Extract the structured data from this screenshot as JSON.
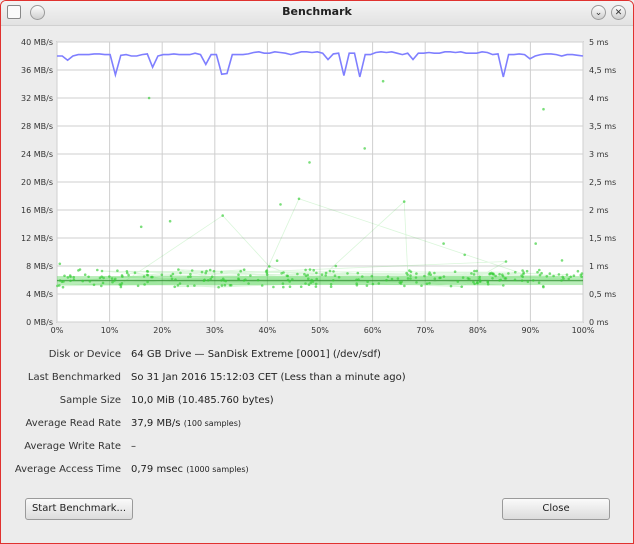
{
  "window": {
    "title": "Benchmark"
  },
  "chart_data": {
    "type": "line",
    "y_left": {
      "label": "",
      "unit": "MB/s",
      "min": 0,
      "max": 40,
      "ticks": [
        "0 MB/s",
        "4 MB/s",
        "8 MB/s",
        "12 MB/s",
        "16 MB/s",
        "20 MB/s",
        "24 MB/s",
        "28 MB/s",
        "32 MB/s",
        "36 MB/s",
        "40 MB/s"
      ]
    },
    "y_right": {
      "label": "",
      "unit": "ms",
      "min": 0,
      "max": 5,
      "ticks": [
        "0 ms",
        "0,5 ms",
        "1 ms",
        "1,5 ms",
        "2 ms",
        "2,5 ms",
        "3 ms",
        "3,5 ms",
        "4 ms",
        "4,5 ms",
        "5 ms"
      ]
    },
    "x_ticks": [
      "0%",
      "10%",
      "20%",
      "30%",
      "40%",
      "50%",
      "60%",
      "70%",
      "80%",
      "90%",
      "100%"
    ],
    "grid": true,
    "read_rate_series": {
      "color": "#7f7fff",
      "x": [
        0,
        1,
        2,
        3,
        4,
        5,
        6,
        7,
        8,
        9,
        10,
        11,
        12,
        13,
        14,
        15,
        16,
        17,
        18,
        19,
        20,
        21,
        22,
        23,
        24,
        25,
        26,
        27,
        28,
        29,
        30,
        31,
        32,
        33,
        34,
        35,
        36,
        37,
        38,
        39,
        40,
        41,
        42,
        43,
        44,
        45,
        46,
        47,
        48,
        49,
        50,
        51,
        52,
        53,
        54,
        55,
        56,
        57,
        58,
        59,
        60,
        61,
        62,
        63,
        64,
        65,
        66,
        67,
        68,
        69,
        70,
        71,
        72,
        73,
        74,
        75,
        76,
        77,
        78,
        79,
        80,
        81,
        82,
        83,
        84,
        85,
        86,
        87,
        88,
        89,
        90,
        91,
        92,
        93,
        94,
        95,
        96,
        97,
        98,
        99
      ],
      "y": [
        38.0,
        38.0,
        37.4,
        38.0,
        38.2,
        38.2,
        38.2,
        38.3,
        38.3,
        38.2,
        38.2,
        35.3,
        38.1,
        38.2,
        38.0,
        38.0,
        38.2,
        38.3,
        36.4,
        38.0,
        38.2,
        38.2,
        38.3,
        38.2,
        38.2,
        38.2,
        38.4,
        38.2,
        36.8,
        38.2,
        38.2,
        35.4,
        35.5,
        38.2,
        38.2,
        38.2,
        38.3,
        38.5,
        38.6,
        38.4,
        38.4,
        38.6,
        38.5,
        38.4,
        38.2,
        38.4,
        38.6,
        38.6,
        38.5,
        38.6,
        38.4,
        37.5,
        38.3,
        38.4,
        35.2,
        38.4,
        38.4,
        35.0,
        38.2,
        38.2,
        38.5,
        38.6,
        38.5,
        38.6,
        38.4,
        38.2,
        38.4,
        37.5,
        38.4,
        38.4,
        38.5,
        38.4,
        38.4,
        38.6,
        38.6,
        38.5,
        38.6,
        38.4,
        38.4,
        38.4,
        38.6,
        38.5,
        38.2,
        38.3,
        35.0,
        38.2,
        38.2,
        38.3,
        38.2,
        37.6,
        38.0,
        38.2,
        38.3,
        38.3,
        38.2,
        38.0,
        38.2,
        38.2,
        38.1,
        38.0
      ]
    },
    "write_rate_series": null,
    "access_time_series": {
      "color": "#33cc33",
      "samples_note": "1000 samples, mostly 0.7-0.9 ms with scattered outliers up to ~4.3 ms",
      "outliers_x": [
        17.5,
        21.5,
        16,
        31.5,
        42.5,
        46,
        48,
        53,
        58.5,
        62,
        66,
        73.5,
        77.5,
        83,
        91,
        92.5,
        96
      ],
      "outliers_ms": [
        4.0,
        1.8,
        1.7,
        1.9,
        2.1,
        2.2,
        2.85,
        1.0,
        3.1,
        4.3,
        2.15,
        1.4,
        1.2,
        0.85,
        1.4,
        3.8,
        1.1
      ]
    }
  },
  "info": {
    "disk_label": "Disk or Device",
    "disk_value": "64 GB Drive — SanDisk Extreme [0001] (/dev/sdf)",
    "last_label": "Last Benchmarked",
    "last_value": "So 31 Jan 2016 15:12:03 CET (Less than a minute ago)",
    "sample_label": "Sample Size",
    "sample_value": "10,0 MiB (10.485.760 bytes)",
    "read_label": "Average Read Rate",
    "read_value": "37,9 MB/s",
    "read_samples": "(100 samples)",
    "write_label": "Average Write Rate",
    "write_value": "–",
    "access_label": "Average Access Time",
    "access_value": "0,79 msec",
    "access_samples": "(1000 samples)"
  },
  "buttons": {
    "start": "Start Benchmark...",
    "close": "Close"
  },
  "icons": {
    "window": "window-icon",
    "menu": "menu-icon",
    "minimize": "minimize-icon",
    "close": "close-icon"
  }
}
